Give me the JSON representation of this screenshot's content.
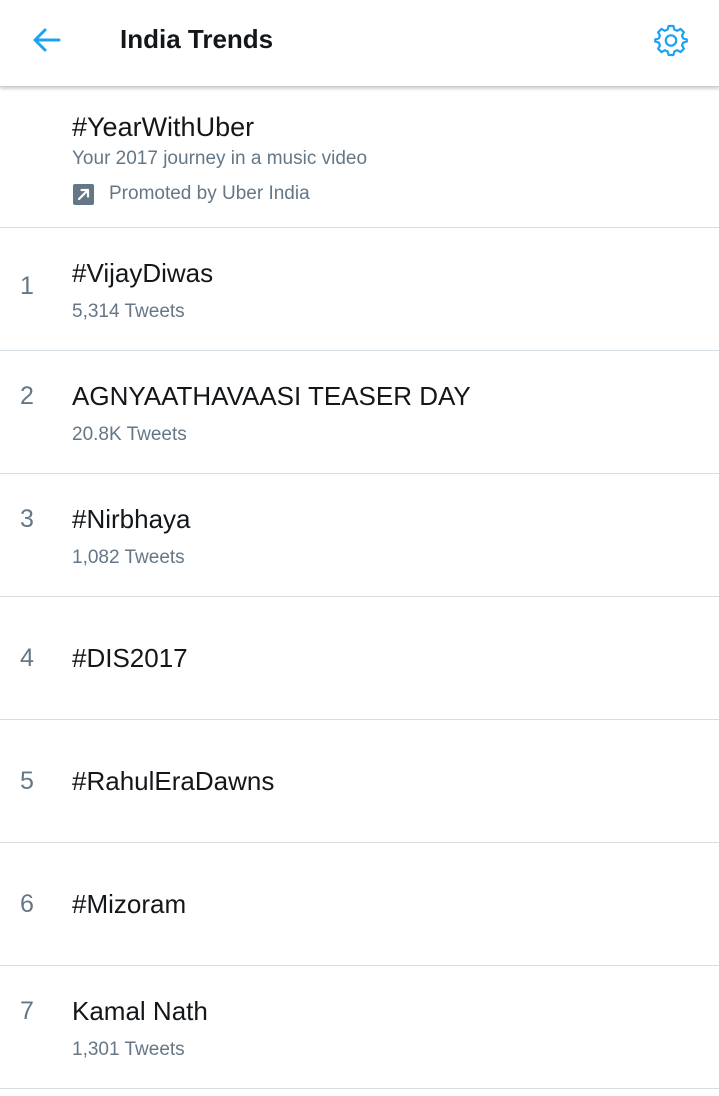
{
  "header": {
    "title": "India Trends",
    "back_icon": "back-arrow-icon",
    "settings_icon": "gear-icon",
    "accent_color": "#1da1f2"
  },
  "promoted": {
    "name": "#YearWithUber",
    "description": "Your 2017 journey in a music video",
    "promoted_by": "Promoted by Uber India",
    "icon": "promoted-arrow-icon"
  },
  "trends": [
    {
      "rank": "1",
      "name": "#VijayDiwas",
      "count": "5,314 Tweets"
    },
    {
      "rank": "2",
      "name": "AGNYAATHAVAASI TEASER DAY",
      "count": "20.8K Tweets"
    },
    {
      "rank": "3",
      "name": "#Nirbhaya",
      "count": "1,082 Tweets"
    },
    {
      "rank": "4",
      "name": "#DIS2017",
      "count": ""
    },
    {
      "rank": "5",
      "name": "#RahulEraDawns",
      "count": ""
    },
    {
      "rank": "6",
      "name": "#Mizoram",
      "count": ""
    },
    {
      "rank": "7",
      "name": "Kamal Nath",
      "count": "1,301 Tweets"
    }
  ]
}
